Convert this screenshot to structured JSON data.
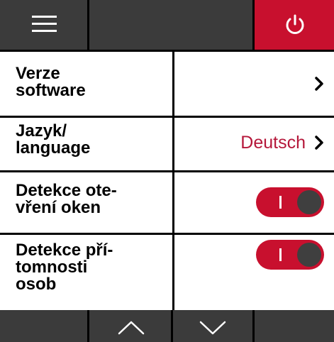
{
  "topbar": {
    "menu_icon": "hamburger-menu-icon",
    "power_icon": "power-icon",
    "power_color": "#c8102e"
  },
  "settings": [
    {
      "label": "Verze software",
      "value": "",
      "control": "chevron"
    },
    {
      "label": "Jazyk/ language",
      "value": "Deutsch",
      "control": "chevron"
    },
    {
      "label": "Detekce otevření oken",
      "control": "toggle",
      "state": "on"
    },
    {
      "label": "Detekce přítomnosti osob",
      "control": "toggle",
      "state": "on"
    }
  ],
  "labels": {
    "row1_line1": "Verze",
    "row1_line2": "software",
    "row2_line1": "Jazyk/",
    "row2_line2": "language",
    "row3_line1": "Detekce ote-",
    "row3_line2": "vření oken",
    "row4_line1": "Detekce pří-",
    "row4_line2": "tomnosti",
    "row4_line3": "osob"
  },
  "language_value": "Deutsch",
  "toggle_on_glyph": "I",
  "bottombar": {
    "up_icon": "chevron-up-icon",
    "down_icon": "chevron-down-icon"
  },
  "colors": {
    "accent": "#c8102e",
    "value_text": "#b5173a",
    "bar_bg": "#3b3b3b"
  }
}
